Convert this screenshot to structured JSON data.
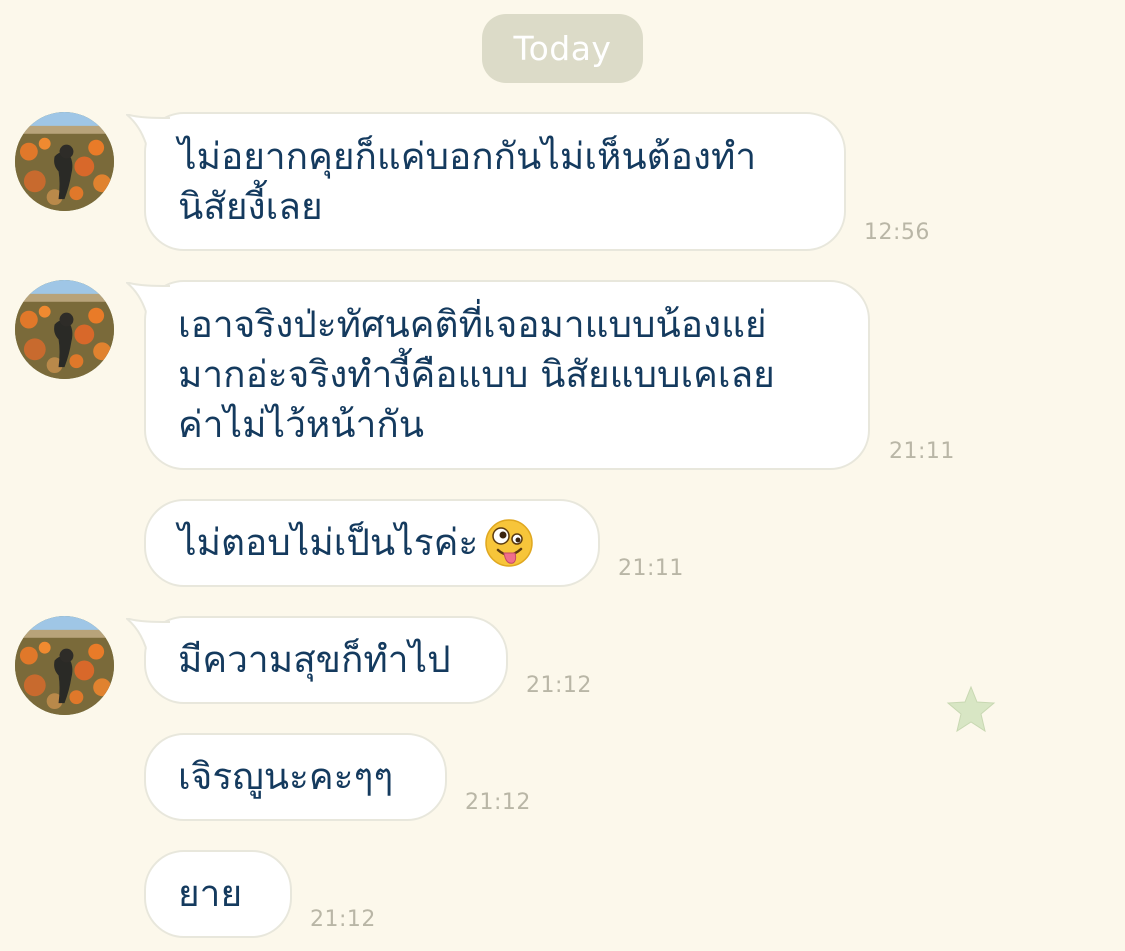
{
  "date_separator": "Today",
  "messages": [
    {
      "lines": [
        "ไม่อยากคุยก็แค่บอกกันไม่เห็นต้องทำ",
        "นิสัยงี้เลย"
      ],
      "time": "12:56",
      "show_avatar": true
    },
    {
      "lines": [
        "เอาจริงป่ะทัศนคติที่เจอมาแบบน้องแย่",
        "มากอ่ะจริงทำงี้คือแบบ นิสัยแบบเคเลย",
        "ค่าไม่ไว้หน้ากัน"
      ],
      "time": "21:11",
      "show_avatar": true
    },
    {
      "lines": [
        "ไม่ตอบไม่เป็นไรค่ะ"
      ],
      "emoji": "zany-face-emoji",
      "time": "21:11",
      "show_avatar": false
    },
    {
      "lines": [
        "มีความสุขก็ทำไป"
      ],
      "time": "21:12",
      "show_avatar": true
    },
    {
      "lines": [
        "เจิรญูนะคะๆๆ"
      ],
      "time": "21:12",
      "show_avatar": false
    },
    {
      "lines": [
        "ยาย"
      ],
      "time": "21:12",
      "show_avatar": false
    }
  ],
  "colors": {
    "background": "#fcf8eb",
    "bubble": "#ffffff",
    "bubble_border": "#e8e7dc",
    "text": "#143a5e",
    "timestamp": "#b9b6a6",
    "date_pill": "#dcdbc8",
    "star": "#d8e6c4"
  },
  "icons": {
    "avatar": "profile-photo-flower-field",
    "sticker": "star-icon"
  }
}
